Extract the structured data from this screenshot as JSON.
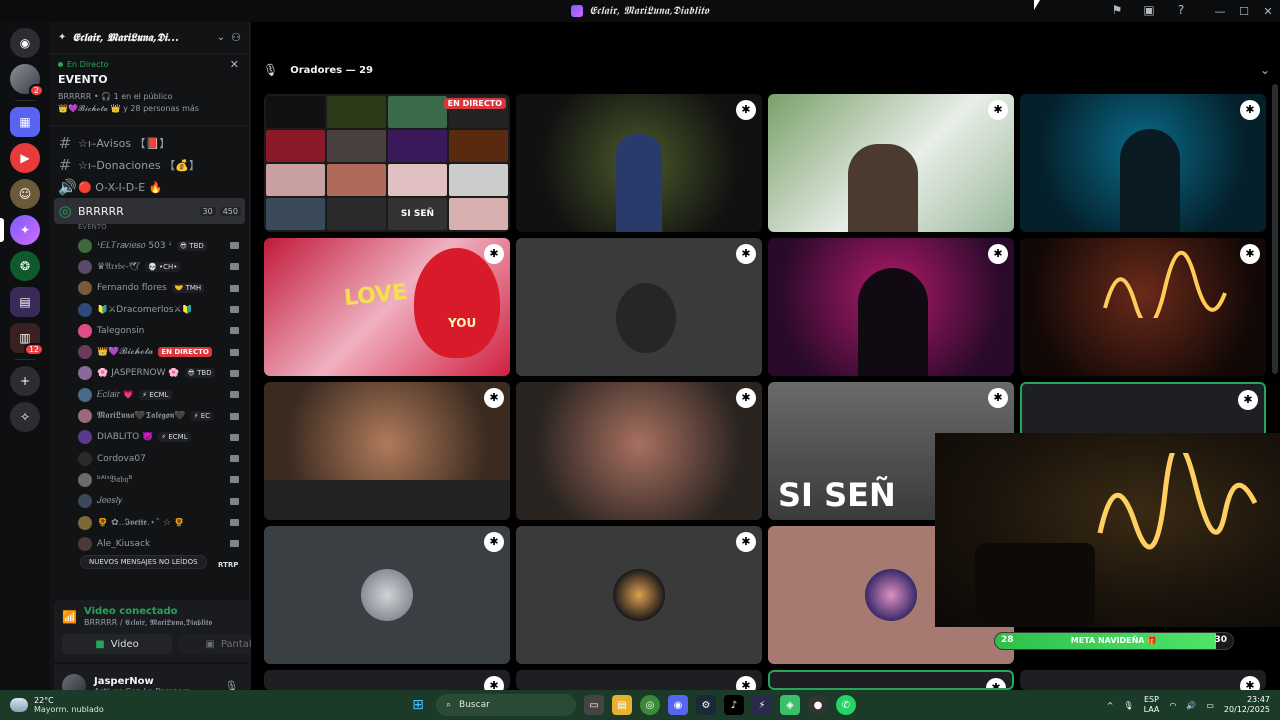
{
  "window": {
    "title": "𝕰𝖈𝖑𝖆𝖎𝖗, 𝕸𝖆𝖗𝖎𝕷𝖚𝖓𝖆,𝕯𝖎𝖆𝖇𝖑𝖎𝖙𝖔"
  },
  "guild": {
    "name": "𝕰𝖈𝖑𝖆𝖎𝖗, 𝕸𝖆𝖗𝖎𝕷𝖚𝖓𝖆,𝕯𝖎..."
  },
  "event": {
    "live_label": "En Directo",
    "title": "EVENTO",
    "line1": "BRRRRR • 🎧 1 en el público",
    "line2": "👑💜𝓑𝓲𝓬𝓱𝓸𝓽𝓪 👑 y 28 personas más"
  },
  "channels": [
    {
      "label": "☆ı–Avisos 【📕】"
    },
    {
      "label": "☆ı–Donaciones 【💰】"
    },
    {
      "label": "🔴 O-X-I-D-E 🔥"
    }
  ],
  "voice_channel": {
    "name": "BRRRRR",
    "sub": "EVENTO",
    "count_a": "30",
    "count_b": "450"
  },
  "voice_users": [
    {
      "name": "ꜜ𝐸𝐿𝑇𝑟𝑎𝑣𝑖𝑒𝑠𝑜 503 ꜜ",
      "tag": "😎 TBD",
      "color": "#3d6a3a",
      "live": false
    },
    {
      "name": "♛𝔄𝔯𝔵𝔟𝔢-🕊",
      "tag": "💀 •CH•",
      "color": "#5a4a6a",
      "live": false
    },
    {
      "name": "Fernando flores",
      "tag": "🤝 TMH",
      "color": "#7a5a3a",
      "live": false
    },
    {
      "name": "🔰⚔Dracomerlos⚔🔰",
      "tag": "",
      "color": "#2b4a7a",
      "live": false
    },
    {
      "name": "Talegonsin",
      "tag": "",
      "color": "#e04e8a",
      "live": false
    },
    {
      "name": "👑💜𝓑𝓲𝓬𝓱𝓸𝓽𝓪",
      "tag": "",
      "color": "#6a3a5a",
      "live": true
    },
    {
      "name": "🌸 JASPERNOW 🌸",
      "tag": "😎 TBD",
      "color": "#8a6a9a",
      "live": false
    },
    {
      "name": "𝐸𝑐𝑙𝑎𝑖𝑟 💗",
      "tag": "⚡ ECML",
      "color": "#4a6a8a",
      "live": false
    },
    {
      "name": "𝕸𝖆𝖗𝖎𝕷𝖚𝖓𝖆🖤𝕿𝖆𝖑𝖊𝖌𝖔𝖓🖤",
      "tag": "⚡ EC",
      "color": "#9a6a7a",
      "live": false
    },
    {
      "name": "DIABLITO 👿",
      "tag": "⚡ ECML",
      "color": "#5a3a8a",
      "live": false
    },
    {
      "name": "Cordova07",
      "tag": "",
      "color": "#2a2a2a",
      "live": false
    },
    {
      "name": "ᵇᴬᴵˢ𝔅𝔞𝔟𝔶ᴮ",
      "tag": "",
      "color": "#6a6a6a",
      "live": false
    },
    {
      "name": "𝐽𝑒𝑒𝑠𝑙𝑦",
      "tag": "",
      "color": "#3a4a5a",
      "live": false
    },
    {
      "name": "🌻 ✿..𝕴𝖛𝖊𝖙𝖙𝖊.⋆˚ ☆ 🌻",
      "tag": "",
      "color": "#7a6a3a",
      "live": false
    },
    {
      "name": "Ale_Kiusack",
      "tag": "",
      "color": "#4a3a3a",
      "live": false
    }
  ],
  "voice_user_live_label": "EN DIRECTO",
  "new_messages": "NUEVOS MENSAJES NO LEÍDOS",
  "new_messages_tail": "RTRP",
  "voice_panel": {
    "status": "Video conectado",
    "channel": "BRRRRR / 𝕰𝖈𝖑𝖆𝖎𝖗, 𝕸𝖆𝖗𝖎𝕷𝖚𝖓𝖆,𝕯𝖎𝖆𝖇𝖑𝖎𝖙𝖔",
    "video_btn": "Video",
    "screen_btn": "Pantalla"
  },
  "user": {
    "name": "JasperNow",
    "status": "Activos Con La Pampara"
  },
  "stage": {
    "header": "Oradores — 29",
    "live_badge": "EN DIRECTO",
    "tile_caption_si": "SI SEÑ",
    "mini_caption": "SI SEÑ",
    "love_text": "LOVE",
    "you_text": "YOU"
  },
  "meta": {
    "label": "META NAVIDEÑA 🎁",
    "current": "28",
    "goal": "30",
    "fraction": 0.93
  },
  "taskbar": {
    "temp": "22°C",
    "weather": "Mayorm. nublado",
    "search": "Buscar",
    "lang1": "ESP",
    "lang2": "LAA",
    "time": "23:47",
    "date": "20/12/2025"
  },
  "rail": {
    "badge_user": "2",
    "badge_bottom": "12"
  },
  "colors": {
    "accent": "#23a55a",
    "live": "#da373c",
    "discord": "#5865f2"
  }
}
